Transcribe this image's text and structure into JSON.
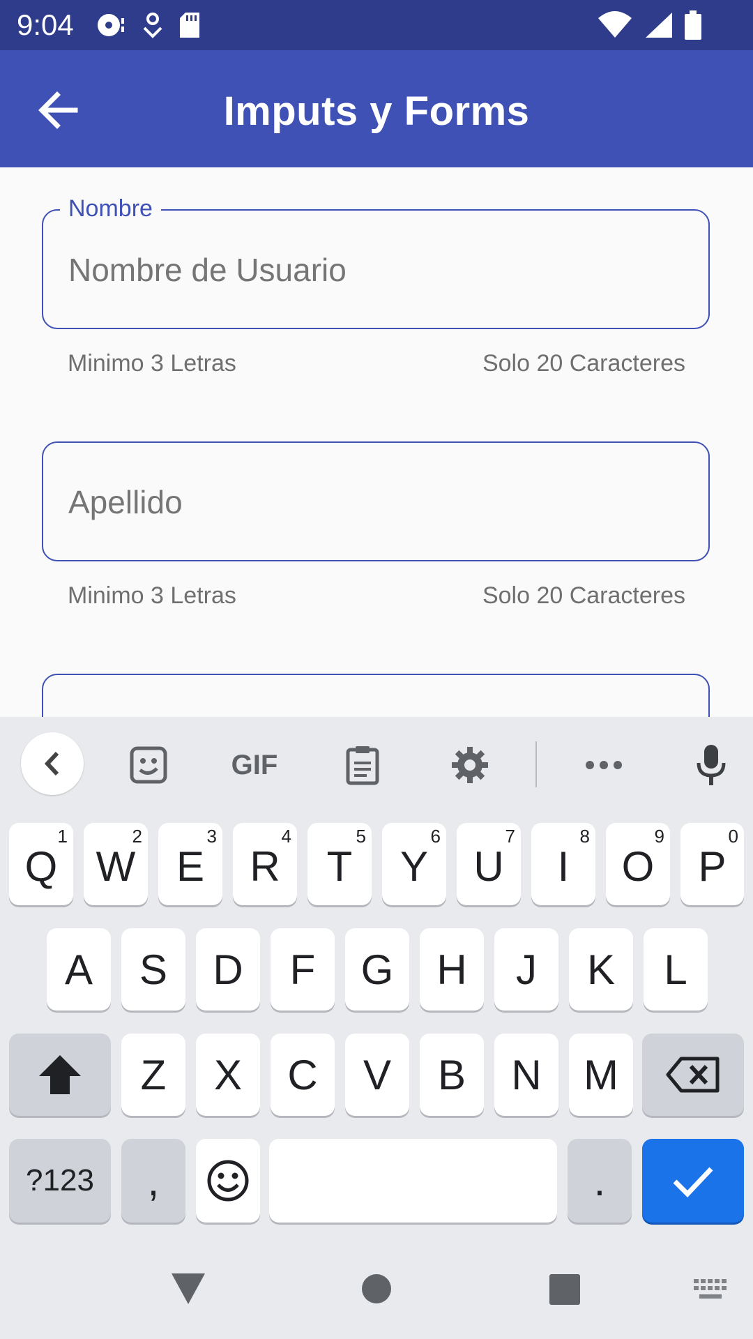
{
  "status_bar": {
    "time": "9:04",
    "left_icons": [
      "hdd-icon",
      "location-icon",
      "sd-card-icon"
    ],
    "right_icons": [
      "wifi-icon",
      "signal-icon",
      "battery-icon"
    ]
  },
  "app_bar": {
    "title": "Imputs y Forms",
    "back_icon": "arrow-left-icon"
  },
  "form": {
    "nombre": {
      "label": "Nombre",
      "placeholder": "Nombre de Usuario",
      "helper_left": "Minimo 3 Letras",
      "helper_right": "Solo 20 Caracteres"
    },
    "apellido": {
      "placeholder": "Apellido",
      "helper_left": "Minimo 3 Letras",
      "helper_right": "Solo 20 Caracteres"
    }
  },
  "keyboard": {
    "toolbar": [
      "collapse-icon",
      "sticker-icon",
      "gif-icon",
      "clipboard-icon",
      "settings-icon",
      "more-icon",
      "mic-icon"
    ],
    "gif_label": "GIF",
    "row1": [
      {
        "k": "Q",
        "n": "1"
      },
      {
        "k": "W",
        "n": "2"
      },
      {
        "k": "E",
        "n": "3"
      },
      {
        "k": "R",
        "n": "4"
      },
      {
        "k": "T",
        "n": "5"
      },
      {
        "k": "Y",
        "n": "6"
      },
      {
        "k": "U",
        "n": "7"
      },
      {
        "k": "I",
        "n": "8"
      },
      {
        "k": "O",
        "n": "9"
      },
      {
        "k": "P",
        "n": "0"
      }
    ],
    "row2": [
      "A",
      "S",
      "D",
      "F",
      "G",
      "H",
      "J",
      "K",
      "L"
    ],
    "row3": [
      "Z",
      "X",
      "C",
      "V",
      "B",
      "N",
      "M"
    ],
    "symbols_label": "?123",
    "comma_label": ",",
    "period_label": "."
  },
  "nav_bar": [
    "back-triangle-icon",
    "home-circle-icon",
    "recents-square-icon",
    "keyboard-switch-icon"
  ],
  "colors": {
    "primary": "#3f51b5",
    "primary_dark": "#2e3c8b",
    "action_key": "#1a73e8"
  }
}
